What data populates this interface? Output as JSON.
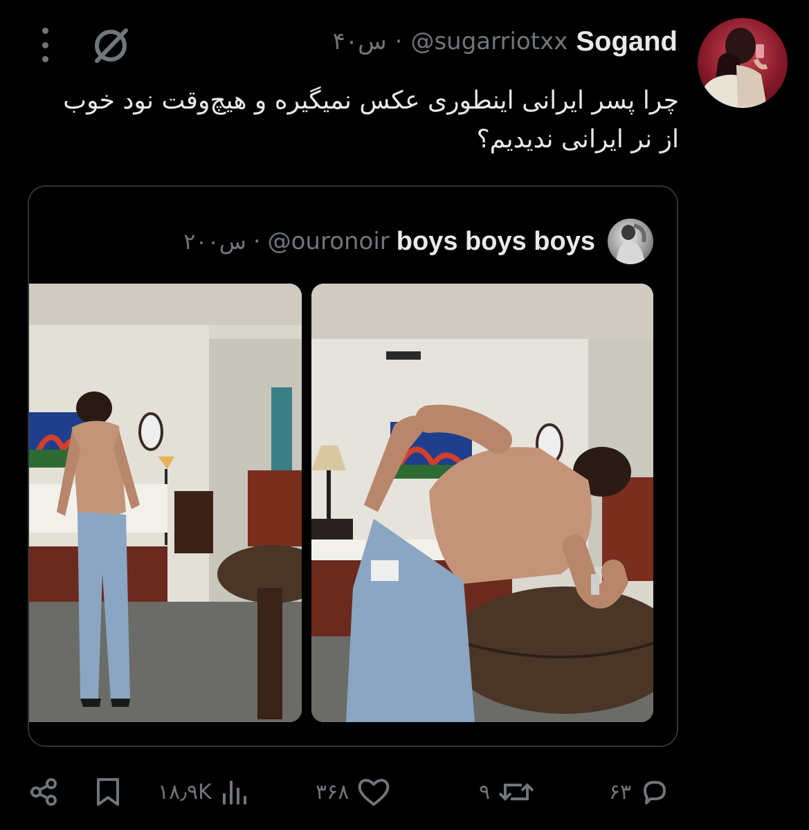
{
  "author": {
    "name": "Sogand",
    "handle": "@sugarriotxx",
    "separator": "·",
    "time": "۴۰س"
  },
  "tweet": {
    "text_line1": "چرا پسر ایرانی اینطوری عکس نمیگیره و هیچ‌وقت نود خوب",
    "text_line2": "از نر ایرانی ندیدیم؟"
  },
  "quote": {
    "name": "boys boys boys",
    "handle": "@ouronoir",
    "separator": "·",
    "time": "۲۰۰س"
  },
  "actions": {
    "replies": "۶۳",
    "retweets": "۹",
    "likes": "۳۶۸",
    "views": "۱۸٫۹K"
  },
  "colors": {
    "background": "#000000",
    "text": "#e7e9ea",
    "muted": "#71767b",
    "border": "#2f3336"
  },
  "icons": [
    "more-icon",
    "grok-icon",
    "reply-icon",
    "retweet-icon",
    "like-icon",
    "views-icon",
    "bookmark-icon",
    "share-icon"
  ]
}
